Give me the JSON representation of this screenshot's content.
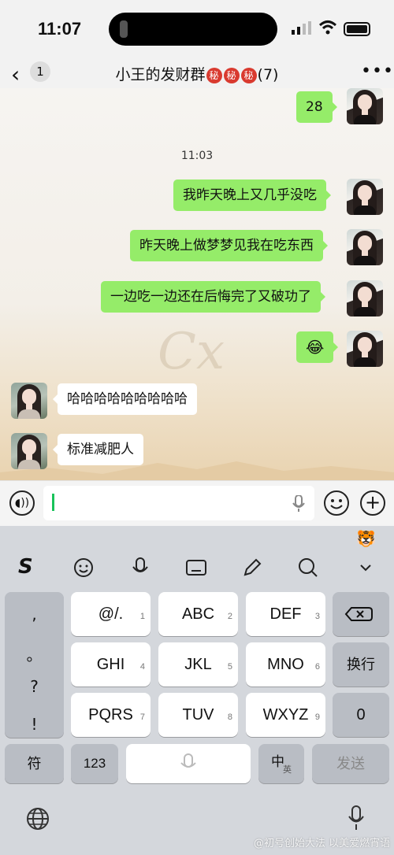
{
  "status": {
    "time": "11:07"
  },
  "nav": {
    "unread_count": "1",
    "group_name": "小王的发财群",
    "secret_badge": "秘",
    "member_count": "(7)"
  },
  "chat": {
    "sent_28": "28",
    "timestamp": "11:03",
    "msg_1": "我昨天晚上又几乎没吃",
    "msg_2": "昨天晚上做梦梦见我在吃东西",
    "msg_3": "一边吃一边还在后悔完了又破功了",
    "msg_4_emoji": "😂",
    "reply_1": "哈哈哈哈哈哈哈哈哈",
    "reply_2": "标准减肥人",
    "wallpaper_mark": "Cx"
  },
  "keyboard": {
    "punct": [
      ",",
      "。",
      "?",
      "!"
    ],
    "row1": [
      {
        "label": "@/.",
        "num": "1"
      },
      {
        "label": "ABC",
        "num": "2"
      },
      {
        "label": "DEF",
        "num": "3"
      }
    ],
    "row2": [
      {
        "label": "GHI",
        "num": "4"
      },
      {
        "label": "JKL",
        "num": "5"
      },
      {
        "label": "MNO",
        "num": "6"
      }
    ],
    "row3": [
      {
        "label": "PQRS",
        "num": "7"
      },
      {
        "label": "TUV",
        "num": "8"
      },
      {
        "label": "WXYZ",
        "num": "9"
      }
    ],
    "newline": "换行",
    "zero": "0",
    "symbols": "符",
    "num_mode": "123",
    "lang_main": "中",
    "lang_sub": "英",
    "send": "发送"
  },
  "credit": "@初号创始大法 以美爱燃宵语",
  "colors": {
    "bubble_me": "#95ec69",
    "bubble_them": "#ffffff",
    "caret": "#19c35a"
  }
}
